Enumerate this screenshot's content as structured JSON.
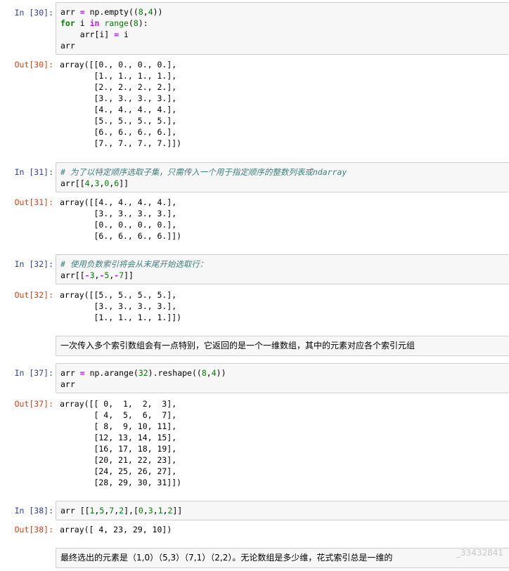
{
  "cells": {
    "c30": {
      "in_prompt": "In  [30]:",
      "out_prompt": "Out[30]:",
      "output": [
        "array([[0., 0., 0., 0.],",
        "       [1., 1., 1., 1.],",
        "       [2., 2., 2., 2.],",
        "       [3., 3., 3., 3.],",
        "       [4., 4., 4., 4.],",
        "       [5., 5., 5., 5.],",
        "       [6., 6., 6., 6.],",
        "       [7., 7., 7., 7.]])"
      ]
    },
    "c31": {
      "in_prompt": "In  [31]:",
      "comment": "# 为了以特定顺序选取子集，只需传入一个用于指定顺序的整数列表或ndarray",
      "out_prompt": "Out[31]:",
      "output": [
        "array([[4., 4., 4., 4.],",
        "       [3., 3., 3., 3.],",
        "       [0., 0., 0., 0.],",
        "       [6., 6., 6., 6.]])"
      ]
    },
    "c32": {
      "in_prompt": "In  [32]:",
      "comment": "# 使用负数索引将会从末尾开始选取行：",
      "out_prompt": "Out[32]:",
      "output": [
        "array([[5., 5., 5., 5.],",
        "       [3., 3., 3., 3.],",
        "       [1., 1., 1., 1.]])"
      ]
    },
    "md1": {
      "text": "一次传入多个索引数组会有一点特别，它返回的是一个一维数组，其中的元素对应各个索引元组"
    },
    "c37": {
      "in_prompt": "In  [37]:",
      "out_prompt": "Out[37]:",
      "output": [
        "array([[ 0,  1,  2,  3],",
        "       [ 4,  5,  6,  7],",
        "       [ 8,  9, 10, 11],",
        "       [12, 13, 14, 15],",
        "       [16, 17, 18, 19],",
        "       [20, 21, 22, 23],",
        "       [24, 25, 26, 27],",
        "       [28, 29, 30, 31]])"
      ]
    },
    "c38": {
      "in_prompt": "In  [38]:",
      "out_prompt": "Out[38]:",
      "output": [
        "array([ 4, 23, 29, 10])"
      ]
    },
    "md2": {
      "text": "最终选出的元素是（1,0）（5,3）（7,1）（2,2）。无论数组是多少维，花式索引总是一维的"
    }
  },
  "watermark": "_33432841",
  "colors": {
    "in_prompt": "#303f9f",
    "out_prompt": "#d84315",
    "keyword": "#008000",
    "operator": "#aa22ff",
    "comment": "#408080",
    "cell_bg": "#f7f7f7",
    "cell_border": "#cfcfcf"
  }
}
